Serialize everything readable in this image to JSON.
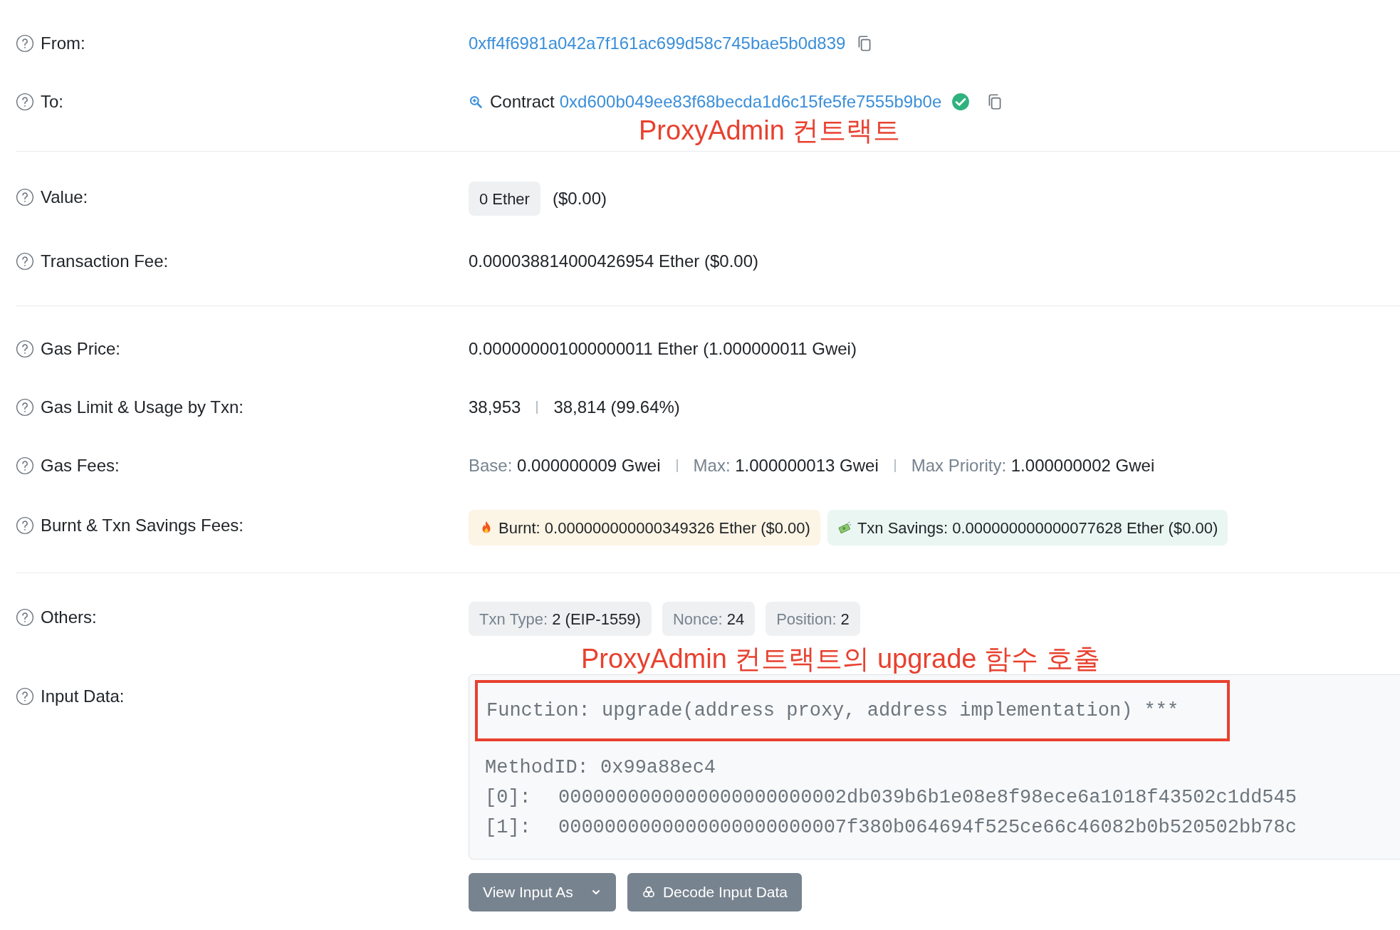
{
  "from": {
    "label": "From:",
    "address": "0xff4f6981a042a7f161ac699d58c745bae5b0d839"
  },
  "to": {
    "label": "To:",
    "prefix": "Contract",
    "address": "0xd600b049ee83f68becda1d6c15fe5fe7555b9b0e",
    "verified": true,
    "annotation": "ProxyAdmin 컨트랙트"
  },
  "value": {
    "label": "Value:",
    "amount": "0 Ether",
    "usd": "($0.00)"
  },
  "transaction_fee": {
    "label": "Transaction Fee:",
    "text": "0.000038814000426954 Ether ($0.00)"
  },
  "gas_price": {
    "label": "Gas Price:",
    "text": "0.000000001000000011 Ether (1.000000011 Gwei)"
  },
  "gas_limit": {
    "label": "Gas Limit & Usage by Txn:",
    "limit": "38,953",
    "usage": "38,814 (99.64%)"
  },
  "gas_fees": {
    "label": "Gas Fees:",
    "items": [
      {
        "name": "Base:",
        "value": "0.000000009 Gwei"
      },
      {
        "name": "Max:",
        "value": "1.000000013 Gwei"
      },
      {
        "name": "Max Priority:",
        "value": "1.000000002 Gwei"
      }
    ]
  },
  "burnt_savings": {
    "label": "Burnt & Txn Savings Fees:",
    "badges": [
      {
        "kind": "burnt",
        "text": "Burnt: 0.000000000000349326 Ether ($0.00)"
      },
      {
        "kind": "savings",
        "text": "Txn Savings: 0.000000000000077628 Ether ($0.00)"
      }
    ]
  },
  "others": {
    "label": "Others:",
    "badges": [
      {
        "name": "Txn Type:",
        "value": "2 (EIP-1559)"
      },
      {
        "name": "Nonce:",
        "value": "24"
      },
      {
        "name": "Position:",
        "value": "2"
      }
    ]
  },
  "input_data": {
    "label": "Input Data:",
    "annotation": "ProxyAdmin 컨트랙트의 upgrade 함수 호출",
    "function": "Function: upgrade(address proxy, address implementation) ***",
    "function_highlighted": true,
    "method_id": "MethodID: 0x99a88ec4",
    "params": [
      {
        "index": "[0]:",
        "value": "0000000000000000000000002db039b6b1e08e8f98ece6a1018f43502c1dd545"
      },
      {
        "index": "[1]:",
        "value": "0000000000000000000000007f380b064694f525ce66c46082b0b520502bb78c"
      }
    ],
    "buttons": [
      {
        "kind": "dropdown",
        "label": "View Input As"
      },
      {
        "kind": "decode",
        "label": "Decode Input Data"
      }
    ]
  }
}
